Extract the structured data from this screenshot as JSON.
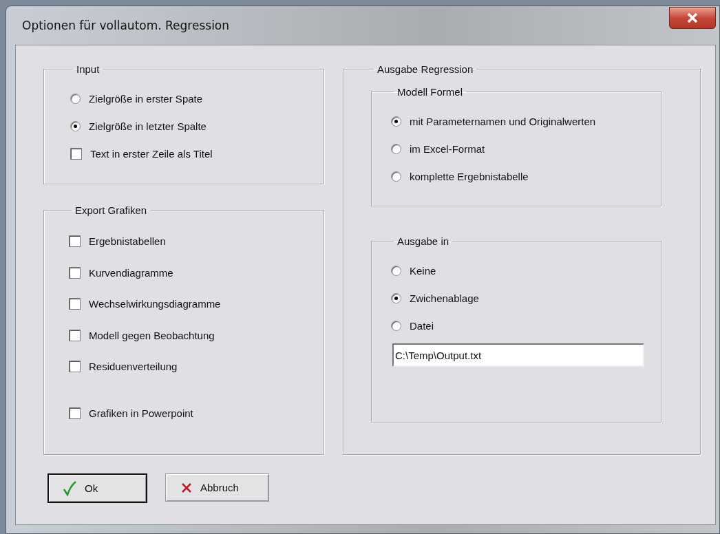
{
  "window": {
    "title": "Optionen für vollautom. Regression"
  },
  "input": {
    "title": "Input",
    "items": [
      {
        "kind": "radio",
        "label": "Zielgröße in erster Spate",
        "selected": false
      },
      {
        "kind": "radio",
        "label": "Zielgröße in letzter Spalte",
        "selected": true
      },
      {
        "kind": "checkbox",
        "label": "Text in erster Zeile als Titel",
        "checked": false
      }
    ]
  },
  "export": {
    "title": "Export Grafiken",
    "items": [
      {
        "kind": "checkbox",
        "label": "Ergebnistabellen",
        "checked": false
      },
      {
        "kind": "checkbox",
        "label": "Kurvendiagramme",
        "checked": false
      },
      {
        "kind": "checkbox",
        "label": "Wechselwirkungsdiagramme",
        "checked": false
      },
      {
        "kind": "checkbox",
        "label": "Modell gegen Beobachtung",
        "checked": false
      },
      {
        "kind": "checkbox",
        "label": "Residuenverteilung",
        "checked": false
      }
    ],
    "extra_items": [
      {
        "kind": "checkbox",
        "label": "Grafiken in Powerpoint",
        "checked": false
      }
    ]
  },
  "output": {
    "title": "Ausgabe Regression",
    "formula": {
      "title": "Modell Formel",
      "items": [
        {
          "kind": "radio",
          "label": "mit Parameternamen und Originalwerten",
          "selected": true
        },
        {
          "kind": "radio",
          "label": "im Excel-Format",
          "selected": false
        },
        {
          "kind": "radio",
          "label": "komplette Ergebnistabelle",
          "selected": false
        }
      ]
    },
    "target": {
      "title": "Ausgabe in",
      "items": [
        {
          "kind": "radio",
          "label": "Keine",
          "selected": false
        },
        {
          "kind": "radio",
          "label": "Zwichenablage",
          "selected": true
        },
        {
          "kind": "radio",
          "label": "Datei",
          "selected": false
        }
      ],
      "file_field": {
        "value": "C:\\Temp\\Output.txt"
      }
    }
  },
  "buttons": [
    {
      "kind": "ok",
      "label": "Ok",
      "default": true
    },
    {
      "kind": "cancel",
      "label": "Abbruch",
      "default": false
    }
  ]
}
